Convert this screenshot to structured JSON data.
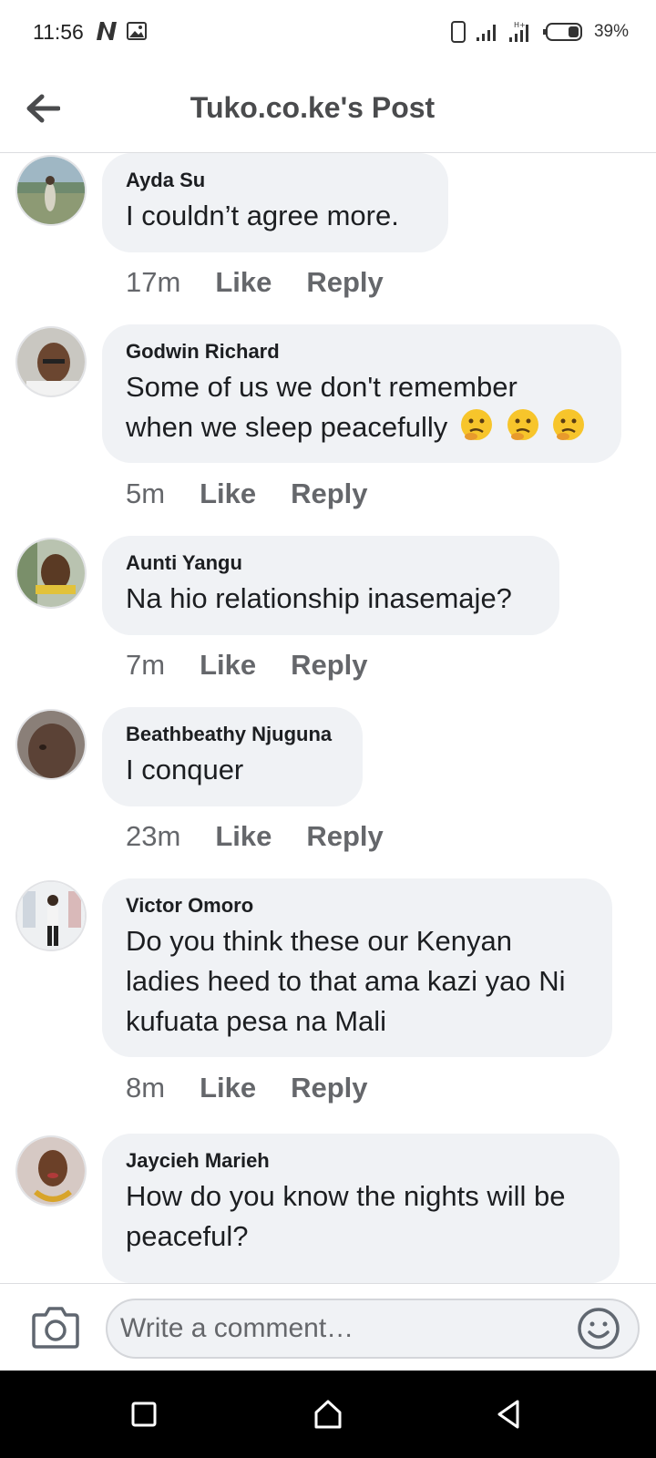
{
  "status_bar": {
    "time": "11:56",
    "battery": "39%"
  },
  "header": {
    "title": "Tuko.co.ke's Post",
    "back_icon": "back-arrow-icon"
  },
  "comments": [
    {
      "author": "Ayda Su",
      "text": "I couldn’t agree more.",
      "time": "17m",
      "like": "Like",
      "reply": "Reply"
    },
    {
      "author": "Godwin Richard",
      "text_line1": "Some of us we don't remember",
      "text_line2": "when we sleep peacefully",
      "emojis": "🤔🤔🤔",
      "time": "5m",
      "like": "Like",
      "reply": "Reply"
    },
    {
      "author": "Aunti Yangu",
      "text": "Na hio relationship inasemaje?",
      "time": "7m",
      "like": "Like",
      "reply": "Reply"
    },
    {
      "author": "Beathbeathy Njuguna",
      "text": "I conquer",
      "time": "23m",
      "like": "Like",
      "reply": "Reply"
    },
    {
      "author": "Victor Omoro",
      "text_line1": "Do you think these our Kenyan",
      "text_line2": "ladies heed to that ama kazi yao Ni",
      "text_line3": "kufuata pesa na Mali",
      "time": "8m",
      "like": "Like",
      "reply": "Reply"
    },
    {
      "author": "Jaycieh Marieh",
      "text_line1": "How do you know the nights will be",
      "text_line2": "peaceful?"
    }
  ],
  "composer": {
    "placeholder": "Write a comment…"
  },
  "colors": {
    "bubble": "#f0f2f5",
    "meta": "#65676b",
    "text": "#1c1e21"
  }
}
